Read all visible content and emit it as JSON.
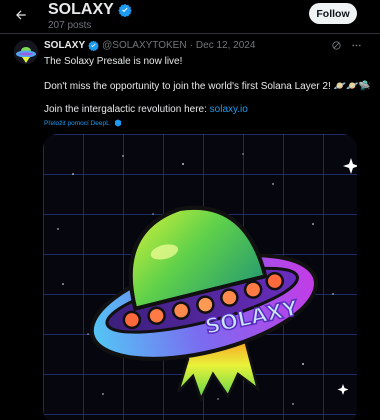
{
  "header": {
    "back_icon": "arrow-left-icon",
    "title": "SOLAXY",
    "verified_icon": "verified-badge-icon",
    "post_count": "207 posts",
    "follow_label": "Follow"
  },
  "tweet": {
    "author": "SOLAXY",
    "handle": "@SOLAXYTOKEN",
    "separator": "·",
    "date": "Dec 12, 2024",
    "line1": "The Solaxy Presale is now live!",
    "line2": "Don't miss the opportunity to join the world's first Solana Layer 2!",
    "line2_emoji": "🪐🪐🛸",
    "line3_prefix": "Join the intergalactic revolution here: ",
    "line3_link": "solaxy.io",
    "translate_label": "Přeložit pomocí DeepL",
    "media_text": "SOLAXY"
  },
  "colors": {
    "accent": "#1d9bf0",
    "background": "#000000",
    "muted": "#71767b"
  }
}
